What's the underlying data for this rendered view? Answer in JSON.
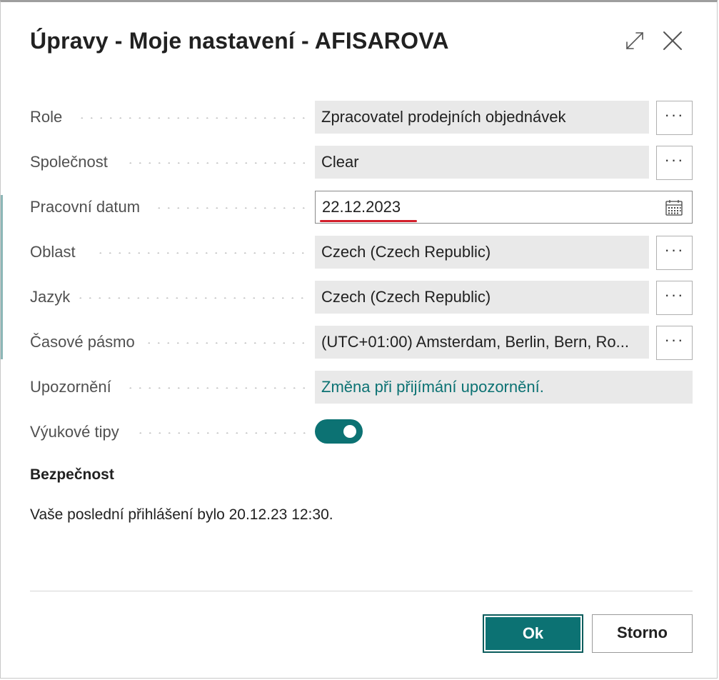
{
  "dialog": {
    "title": "Úpravy - Moje nastavení - AFISAROVA"
  },
  "fields": {
    "role": {
      "label": "Role",
      "value": "Zpracovatel prodejních objednávek",
      "lookup": "···"
    },
    "company": {
      "label": "Společnost",
      "value": "Clear",
      "lookup": "···"
    },
    "work_date": {
      "label": "Pracovní datum",
      "value": "22.12.2023"
    },
    "region": {
      "label": "Oblast",
      "value": "Czech (Czech Republic)",
      "lookup": "···"
    },
    "language": {
      "label": "Jazyk",
      "value": "Czech (Czech Republic)",
      "lookup": "···"
    },
    "timezone": {
      "label": "Časové pásmo",
      "value": "(UTC+01:00) Amsterdam, Berlin, Bern, Ro...",
      "lookup": "···"
    },
    "notifications": {
      "label": "Upozornění",
      "value": "Změna při přijímání upozornění."
    },
    "teaching_tips": {
      "label": "Výukové tipy",
      "enabled": true
    }
  },
  "security": {
    "title": "Bezpečnost",
    "last_login": "Vaše poslední přihlášení bylo 20.12.23 12:30."
  },
  "buttons": {
    "ok": "Ok",
    "cancel": "Storno"
  },
  "colors": {
    "accent": "#0c7273",
    "annotation_underline": "#d21f2b"
  }
}
